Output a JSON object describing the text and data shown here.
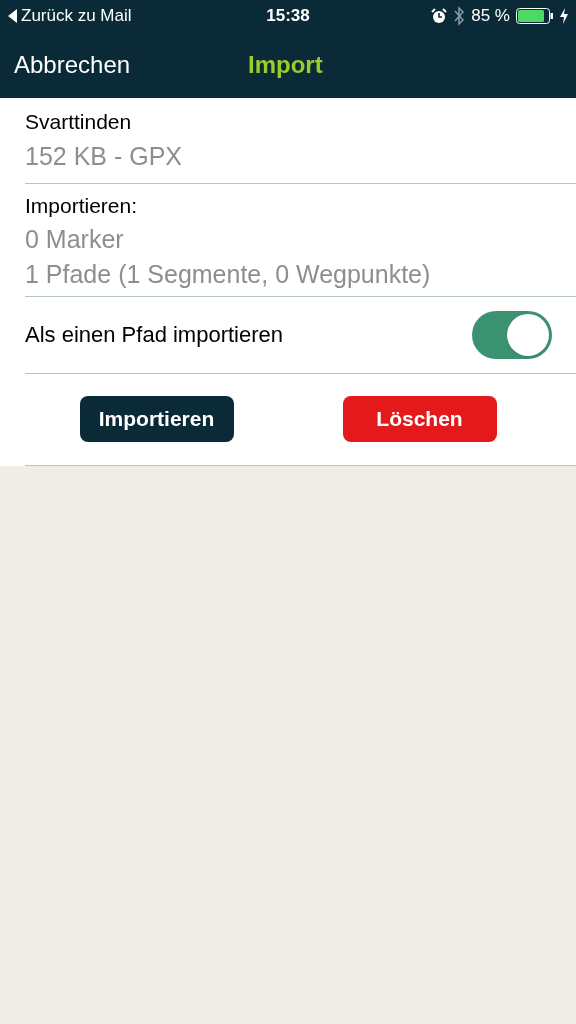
{
  "status_bar": {
    "back": "Zurück zu Mail",
    "time": "15:38",
    "battery": "85 %"
  },
  "nav": {
    "cancel": "Abbrechen",
    "title": "Import"
  },
  "file": {
    "name": "Svarttinden",
    "info": "152 KB - GPX"
  },
  "summary": {
    "heading": "Importieren:",
    "lines": [
      "0 Marker",
      "1 Pfade (1 Segmente, 0 Wegpunkte)"
    ]
  },
  "option": {
    "label": "Als einen Pfad importieren",
    "on": true
  },
  "buttons": [
    {
      "label": "Importieren",
      "kind": "primary"
    },
    {
      "label": "Löschen",
      "kind": "danger"
    }
  ]
}
